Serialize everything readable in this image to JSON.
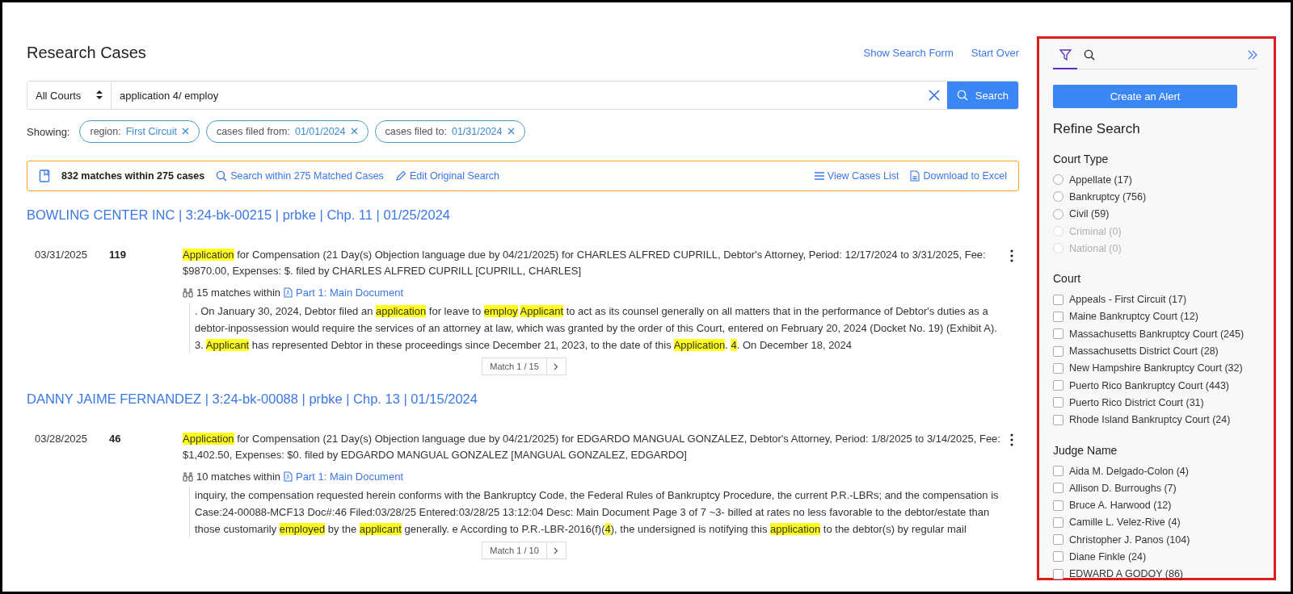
{
  "page": {
    "title": "Research Cases",
    "links": [
      "Show Search Form",
      "Start Over"
    ]
  },
  "search": {
    "court_select": "All Courts",
    "query": "application 4/ employ",
    "button": "Search"
  },
  "filters": {
    "label": "Showing:",
    "chips": [
      {
        "name": "region:",
        "value": "First Circuit"
      },
      {
        "name": "cases filed from:",
        "value": "01/01/2024"
      },
      {
        "name": "cases filed to:",
        "value": "01/31/2024"
      }
    ]
  },
  "summary": {
    "count": "832 matches within 275 cases",
    "left_actions": [
      {
        "kind": "search",
        "label": "Search within 275 Matched Cases"
      },
      {
        "kind": "edit",
        "label": "Edit Original Search"
      }
    ],
    "right_actions": [
      {
        "kind": "list",
        "label": "View Cases List"
      },
      {
        "kind": "excel",
        "label": "Download to Excel"
      }
    ]
  },
  "cases": [
    {
      "title": "BOWLING CENTER INC | 3:24-bk-00215 | prbke | Chp. 11 | 01/25/2024",
      "entries": [
        {
          "date": "03/31/2025",
          "number": "119",
          "description": [
            {
              "text": "Application",
              "highlight": true
            },
            {
              "text": " for Compensation (21 Day(s) Objection language due by 04/21/2025) for CHARLES ALFRED CUPRILL, Debtor's Attorney, Period: 12/17/2024 to 3/31/2025, Fee: $9870.00, Expenses: $. filed by CHARLES ALFRED CUPRILL [CUPRILL, CHARLES]",
              "highlight": false
            }
          ],
          "matches": "15 matches within",
          "document": "Part 1: Main Document",
          "excerpt": [
            {
              "text": ". On January 30, 2024, Debtor filed an ",
              "highlight": false
            },
            {
              "text": "application",
              "highlight": true
            },
            {
              "text": " for leave to ",
              "highlight": false
            },
            {
              "text": "employ",
              "highlight": true
            },
            {
              "text": "Applicant",
              "highlight": true
            },
            {
              "text": " to act as its counsel generally on all matters that in the performance of Debtor's duties as a debtor-inpossession would require the services of an attorney at law, which was granted by the order of this Court, entered on February 20, 2024 (Docket No. 19) (Exhibit A). 3. ",
              "highlight": false
            },
            {
              "text": "Applicant",
              "highlight": true
            },
            {
              "text": " has represented Debtor in these proceedings since December 21, 2023, to the date of this ",
              "highlight": false
            },
            {
              "text": "Application",
              "highlight": true
            },
            {
              "text": ". ",
              "highlight": false
            },
            {
              "text": "4",
              "highlight": true
            },
            {
              "text": ". On December 18, 2024",
              "highlight": false
            }
          ],
          "pager": "Match 1 / 15"
        }
      ]
    },
    {
      "title": "DANNY JAIME FERNANDEZ | 3:24-bk-00088 | prbke | Chp. 13 | 01/15/2024",
      "entries": [
        {
          "date": "03/28/2025",
          "number": "46",
          "description": [
            {
              "text": "Application",
              "highlight": true
            },
            {
              "text": " for Compensation (21 Day(s) Objection language due by 04/21/2025) for EDGARDO MANGUAL GONZALEZ, Debtor's Attorney, Period: 1/8/2025 to 3/14/2025, Fee: $1,402.50, Expenses: $0. filed by EDGARDO MANGUAL GONZALEZ [MANGUAL GONZALEZ, EDGARDO]",
              "highlight": false
            }
          ],
          "matches": "10 matches within",
          "document": "Part 1: Main Document",
          "excerpt": [
            {
              "text": "inquiry, the compensation requested herein conforms with the Bankruptcy Code, the Federal Rules of Bankruptcy Procedure, the current P.R.-LBRs; and the compensation is Case:24-00088-MCF13 Doc#:46 Filed:03/28/25 Entered:03/28/25 13:12:04 Desc: Main Document Page 3 of 7 ~3- billed at rates no less favorable to the debtor/estate than those customarily ",
              "highlight": false
            },
            {
              "text": "employed",
              "highlight": true
            },
            {
              "text": " by the ",
              "highlight": false
            },
            {
              "text": "applicant",
              "highlight": true
            },
            {
              "text": " generally. e According to P.R.-LBR-2016(f)(",
              "highlight": false
            },
            {
              "text": "4",
              "highlight": true
            },
            {
              "text": "), the undersigned is notifying this ",
              "highlight": false
            },
            {
              "text": "application",
              "highlight": true
            },
            {
              "text": " to the debtor(s) by regular mail",
              "highlight": false
            }
          ],
          "pager": "Match 1 / 10"
        }
      ]
    }
  ],
  "sidebar": {
    "tabs": [
      {
        "kind": "filter",
        "selected": true
      },
      {
        "kind": "search",
        "selected": false
      }
    ],
    "alert_button": "Create an Alert",
    "heading": "Refine Search",
    "groups": [
      {
        "title": "Court Type",
        "kind": "radio",
        "options": [
          {
            "label": "Appellate (17)",
            "selected": false,
            "disabled": false
          },
          {
            "label": "Bankruptcy (756)",
            "selected": false,
            "disabled": false
          },
          {
            "label": "Civil (59)",
            "selected": false,
            "disabled": false
          },
          {
            "label": "Criminal (0)",
            "selected": false,
            "disabled": true
          },
          {
            "label": "National (0)",
            "selected": false,
            "disabled": true
          }
        ]
      },
      {
        "title": "Court",
        "kind": "checkbox",
        "options": [
          {
            "label": "Appeals - First Circuit (17)",
            "checked": false
          },
          {
            "label": "Maine Bankruptcy Court (12)",
            "checked": false
          },
          {
            "label": "Massachusetts Bankruptcy Court (245)",
            "checked": false
          },
          {
            "label": "Massachusetts District Court (28)",
            "checked": false
          },
          {
            "label": "New Hampshire Bankruptcy Court (32)",
            "checked": false
          },
          {
            "label": "Puerto Rico Bankruptcy Court (443)",
            "checked": false
          },
          {
            "label": "Puerto Rico District Court (31)",
            "checked": false
          },
          {
            "label": "Rhode Island Bankruptcy Court (24)",
            "checked": false
          }
        ]
      },
      {
        "title": "Judge Name",
        "kind": "checkbox",
        "options": [
          {
            "label": "Aida M. Delgado-Colon (4)",
            "checked": false
          },
          {
            "label": "Allison D. Burroughs (7)",
            "checked": false
          },
          {
            "label": "Bruce A. Harwood (12)",
            "checked": false
          },
          {
            "label": "Camille L. Velez-Rive (4)",
            "checked": false
          },
          {
            "label": "Christopher J. Panos (104)",
            "checked": false
          },
          {
            "label": "Diane Finkle (24)",
            "checked": false
          },
          {
            "label": "EDWARD A GODOY (86)",
            "checked": false
          }
        ]
      }
    ]
  }
}
